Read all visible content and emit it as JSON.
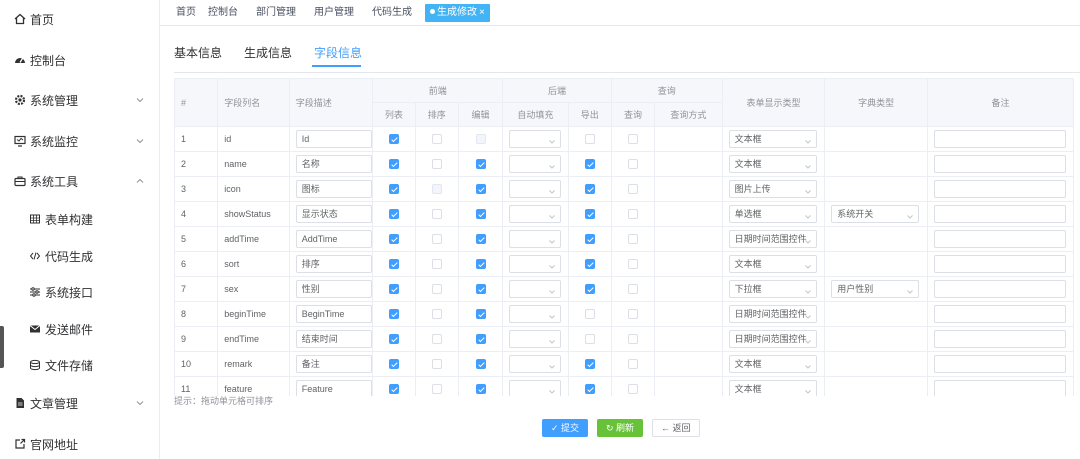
{
  "sidebar": {
    "items": [
      {
        "label": "首页",
        "icon": "home-icon"
      },
      {
        "label": "控制台",
        "icon": "dashboard-icon"
      },
      {
        "label": "系统管理",
        "icon": "gear-icon",
        "expandable": true
      },
      {
        "label": "系统监控",
        "icon": "monitor-icon",
        "expandable": true
      },
      {
        "label": "系统工具",
        "icon": "toolbox-icon",
        "expandable": true,
        "expanded": true
      },
      {
        "label": "表单构建",
        "icon": "form-grid-icon",
        "sub": true
      },
      {
        "label": "代码生成",
        "icon": "code-icon",
        "sub": true
      },
      {
        "label": "系统接口",
        "icon": "sliders-icon",
        "sub": true
      },
      {
        "label": "发送邮件",
        "icon": "mail-icon",
        "sub": true
      },
      {
        "label": "文件存储",
        "icon": "storage-icon",
        "sub": true
      },
      {
        "label": "文章管理",
        "icon": "document-icon",
        "expandable": true
      },
      {
        "label": "官网地址",
        "icon": "external-link-icon"
      }
    ]
  },
  "tags": [
    {
      "label": "首页"
    },
    {
      "label": "控制台"
    },
    {
      "label": "部门管理"
    },
    {
      "label": "用户管理"
    },
    {
      "label": "代码生成"
    },
    {
      "label": "生成修改",
      "active": true
    }
  ],
  "tabs": [
    {
      "label": "基本信息"
    },
    {
      "label": "生成信息"
    },
    {
      "label": "字段信息",
      "active": true
    }
  ],
  "table": {
    "group_headers": {
      "front": "前端",
      "back": "后端",
      "query": "查询"
    },
    "headers": {
      "index": "#",
      "column_name": "字段列名",
      "column_desc": "字段描述",
      "list": "列表",
      "sort": "排序",
      "edit": "编辑",
      "autofill": "自动填充",
      "export": "导出",
      "query": "查询",
      "query_mode": "查询方式",
      "form_type": "表单显示类型",
      "dict_type": "字典类型",
      "remark": "备注"
    },
    "rows": [
      {
        "index": "1",
        "name": "id",
        "desc": "Id",
        "list": true,
        "sort": false,
        "edit": false,
        "edit_disabled": true,
        "export": false,
        "query": false,
        "form_type": "文本框",
        "dict": ""
      },
      {
        "index": "2",
        "name": "name",
        "desc": "名称",
        "list": true,
        "sort": false,
        "edit": true,
        "export": true,
        "query": false,
        "form_type": "文本框",
        "dict": ""
      },
      {
        "index": "3",
        "name": "icon",
        "desc": "图标",
        "list": true,
        "sort": false,
        "sort_disabled": true,
        "edit": true,
        "export": true,
        "query": false,
        "form_type": "图片上传",
        "dict": ""
      },
      {
        "index": "4",
        "name": "showStatus",
        "desc": "显示状态",
        "list": true,
        "sort": false,
        "edit": true,
        "export": true,
        "query": false,
        "form_type": "单选框",
        "dict": "系统开关"
      },
      {
        "index": "5",
        "name": "addTime",
        "desc": "AddTime",
        "list": true,
        "sort": false,
        "edit": true,
        "export": true,
        "query": false,
        "form_type": "日期时间范围控件",
        "dict": ""
      },
      {
        "index": "6",
        "name": "sort",
        "desc": "排序",
        "list": true,
        "sort": false,
        "edit": true,
        "export": true,
        "query": false,
        "form_type": "文本框",
        "dict": ""
      },
      {
        "index": "7",
        "name": "sex",
        "desc": "性别",
        "list": true,
        "sort": false,
        "edit": true,
        "export": true,
        "query": false,
        "form_type": "下拉框",
        "dict": "用户性别"
      },
      {
        "index": "8",
        "name": "beginTime",
        "desc": "BeginTime",
        "list": true,
        "sort": false,
        "edit": true,
        "export": false,
        "query": false,
        "form_type": "日期时间范围控件",
        "dict": ""
      },
      {
        "index": "9",
        "name": "endTime",
        "desc": "结束时间",
        "list": true,
        "sort": false,
        "edit": true,
        "export": false,
        "query": false,
        "form_type": "日期时间范围控件",
        "dict": ""
      },
      {
        "index": "10",
        "name": "remark",
        "desc": "备注",
        "list": true,
        "sort": false,
        "edit": true,
        "export": true,
        "query": false,
        "form_type": "文本框",
        "dict": ""
      },
      {
        "index": "11",
        "name": "feature",
        "desc": "Feature",
        "list": true,
        "sort": false,
        "edit": true,
        "export": true,
        "query": false,
        "form_type": "文本框",
        "dict": ""
      }
    ]
  },
  "tip": "提示：拖动单元格可排序",
  "buttons": {
    "submit": "提交",
    "refresh": "刷新",
    "back": "返回"
  },
  "colors": {
    "primary": "#409eff",
    "success": "#67c23a",
    "front_header": "#67c23a",
    "back_header": "#f56c9c"
  }
}
